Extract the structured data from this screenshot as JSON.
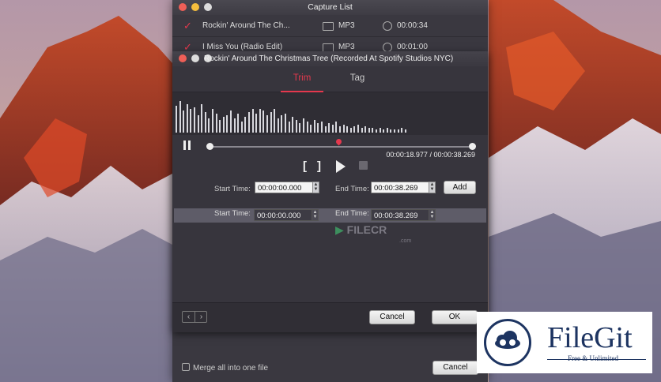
{
  "capture_list": {
    "title": "Capture List",
    "rows": [
      {
        "name": "Rockin' Around The Ch...",
        "format": "MP3",
        "duration": "00:00:34"
      },
      {
        "name": "I Miss You (Radio Edit)",
        "format": "MP3",
        "duration": "00:01:00"
      }
    ],
    "merge_label": "Merge all into one file",
    "cancel_label": "Cancel"
  },
  "dialog": {
    "title": "Rockin' Around The Christmas Tree (Recorded At Spotify Studios NYC)",
    "tabs": [
      "Trim",
      "Tag"
    ],
    "active_tab": "Trim",
    "time_readout": "00:00:18.977 / 00:00:38.269",
    "playhead_fraction": 0.49,
    "start_label": "Start Time:",
    "end_label": "End Time:",
    "start_value": "00:00:00.000",
    "end_value": "00:00:38.269",
    "add_label": "Add",
    "segment": {
      "start_value": "00:00:00.000",
      "end_value": "00:00:38.269"
    },
    "cancel_label": "Cancel",
    "ok_label": "OK"
  },
  "watermark": {
    "text": "FILECR",
    "sub": ".com"
  },
  "badge": {
    "brand": "FileGit",
    "tagline": "Free & Unlimited"
  },
  "colors": {
    "accent": "#e5384d",
    "brand": "#1d3461"
  }
}
